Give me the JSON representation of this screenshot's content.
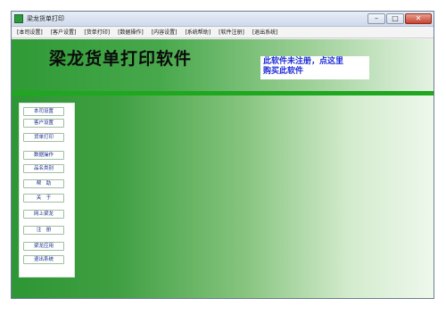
{
  "window": {
    "title": "梁龙货单打印",
    "controls": {
      "minimize": "–",
      "maximize": "□",
      "close": "✕"
    }
  },
  "menu": [
    "[本司设置]",
    "[客户设置]",
    "[货单打印]",
    "[数据操作]",
    "[内容设置]",
    "[系统帮助]",
    "[软件注册]",
    "[退出系统]"
  ],
  "banner": {
    "title": "梁龙货单打印软件",
    "notice_line1": "此软件未注册，点这里",
    "notice_line2": "购买此软件"
  },
  "sidebar": [
    "本司设置",
    "客户设置",
    "货单打印",
    "数据操作",
    "品名类别",
    "帮　助",
    "关　于",
    "网上梁龙",
    "注　册",
    "梁龙应用",
    "退出系统"
  ],
  "colors": {
    "banner_start": "#2f9a36",
    "stripe": "#1fa81f",
    "notice_text": "#1f2ed6"
  }
}
